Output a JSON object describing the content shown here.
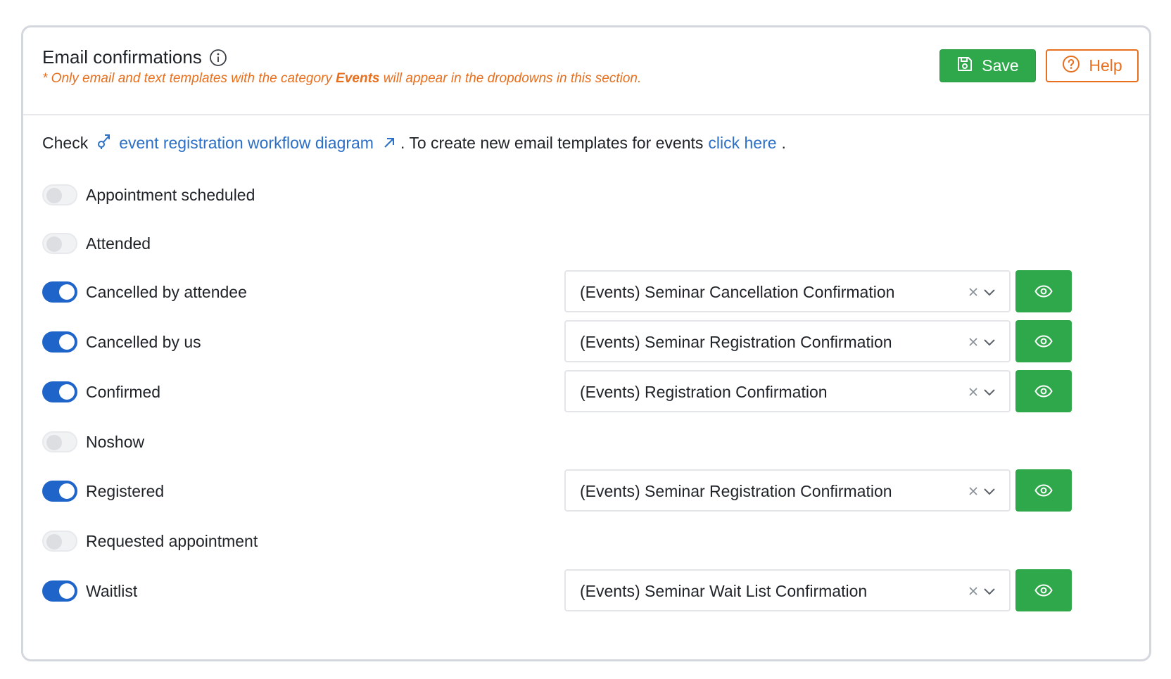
{
  "header": {
    "title": "Email confirmations",
    "note_prefix": "* Only email and text templates with the category ",
    "note_bold": "Events",
    "note_suffix": " will appear in the dropdowns in this section.",
    "save_label": "Save",
    "help_label": "Help"
  },
  "intro": {
    "check_text": "Check",
    "diagram_link": "event registration workflow diagram",
    "middle_text": ". To create new email templates for events",
    "click_here": "click here",
    "end_text": "."
  },
  "rows": [
    {
      "label": "Appointment scheduled",
      "enabled": false,
      "template": null
    },
    {
      "label": "Attended",
      "enabled": false,
      "template": null
    },
    {
      "label": "Cancelled by attendee",
      "enabled": true,
      "template": "(Events) Seminar Cancellation Confirmation"
    },
    {
      "label": "Cancelled by us",
      "enabled": true,
      "template": "(Events) Seminar Registration Confirmation"
    },
    {
      "label": "Confirmed",
      "enabled": true,
      "template": "(Events) Registration Confirmation"
    },
    {
      "label": "Noshow",
      "enabled": false,
      "template": null
    },
    {
      "label": "Registered",
      "enabled": true,
      "template": "(Events) Seminar Registration Confirmation"
    },
    {
      "label": "Requested appointment",
      "enabled": false,
      "template": null
    },
    {
      "label": "Waitlist",
      "enabled": true,
      "template": "(Events) Seminar Wait List Confirmation"
    }
  ],
  "colors": {
    "accent_orange": "#e76f1d",
    "save_green": "#2ea84a",
    "toggle_blue": "#1f64c8",
    "link_blue": "#2b6fc6"
  },
  "icons": {
    "title": "info-icon",
    "save": "floppy-disk-icon",
    "help": "question-circle-icon",
    "diagram": "workflow-icon",
    "external": "external-link-icon",
    "clear": "clear-x-icon",
    "dropdown": "chevron-down-icon",
    "preview": "eye-icon"
  }
}
